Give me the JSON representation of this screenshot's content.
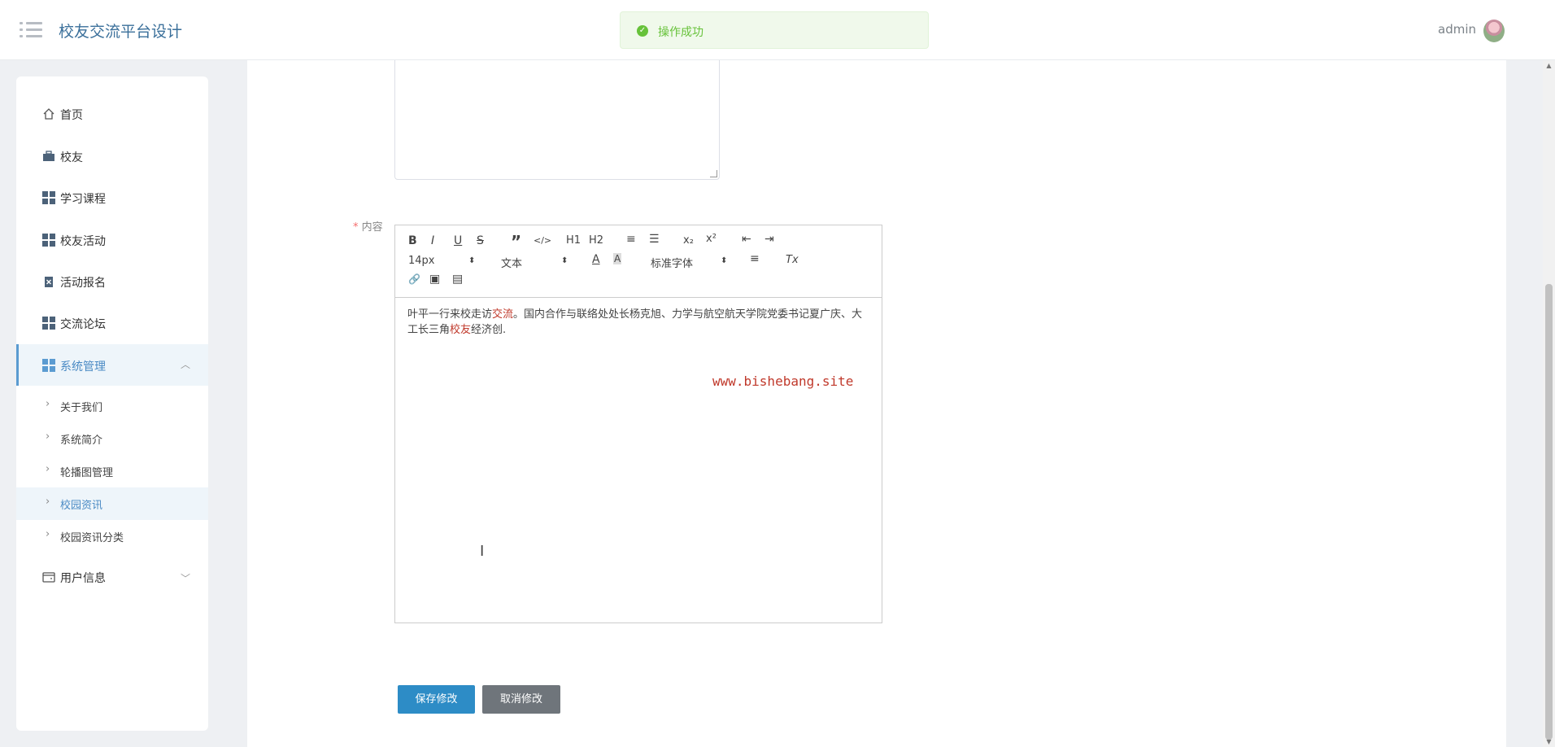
{
  "app": {
    "title": "校友交流平台设计"
  },
  "toast": {
    "text": "操作成功"
  },
  "user": {
    "name": "admin"
  },
  "sidebar": {
    "items": [
      {
        "label": "首页",
        "icon": "home-icon"
      },
      {
        "label": "校友",
        "icon": "briefcase-icon"
      },
      {
        "label": "学习课程",
        "icon": "grid-icon"
      },
      {
        "label": "校友活动",
        "icon": "grid-icon"
      },
      {
        "label": "活动报名",
        "icon": "clipboard-icon"
      },
      {
        "label": "交流论坛",
        "icon": "grid-icon"
      },
      {
        "label": "系统管理",
        "icon": "grid-icon"
      },
      {
        "label": "用户信息",
        "icon": "wallet-icon"
      }
    ],
    "subitems": [
      {
        "label": "关于我们"
      },
      {
        "label": "系统简介"
      },
      {
        "label": "轮播图管理"
      },
      {
        "label": "校园资讯"
      },
      {
        "label": "校园资讯分类"
      }
    ]
  },
  "form": {
    "content_label": "内容",
    "required_mark": "*"
  },
  "editor": {
    "toolbar": {
      "bold": "B",
      "italic": "I",
      "underline": "U",
      "strike": "S",
      "quote": "”",
      "code": "</>",
      "h1": "H1",
      "h2": "H2",
      "ol": "≡",
      "ul": "☰",
      "sub": "x₂",
      "sup": "x²",
      "outdent": "⇤",
      "indent": "⇥",
      "size": "14px",
      "block": "文本",
      "font": "标准字体",
      "color": "A",
      "bg": "A",
      "align": "≡",
      "clean": "Tx",
      "link": "🔗",
      "image": "▣",
      "video": "▤"
    },
    "content": {
      "part1": "叶平一行来校走访",
      "red1": "交流",
      "part2": "。国内合作与联络处处长杨克旭、力学与航空航天学院党委书记夏广庆、大工长三角",
      "red2": "校友",
      "part3": "经济创."
    },
    "watermark": "www.bishebang.site",
    "cursor": "I"
  },
  "buttons": {
    "save": "保存修改",
    "cancel": "取消修改"
  }
}
